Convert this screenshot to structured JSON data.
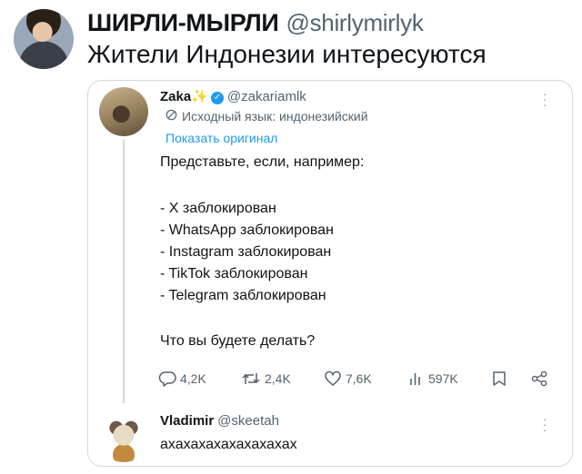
{
  "outer_post": {
    "display_name": "ШИРЛИ-МЫРЛИ",
    "handle": "@shirlymirlyk",
    "text": "Жители Индонезии интересуются"
  },
  "quoted_post": {
    "display_name": "Zaka",
    "name_emoji": "✨",
    "verified": true,
    "handle": "@zakariamlk",
    "translation_note": "Исходный язык: индонезийский",
    "show_original": "Показать оригинал",
    "lines": [
      "Представьте, если, например:",
      "- X заблокирован",
      "- WhatsApp заблокирован",
      "- Instagram заблокирован",
      "- TikTok заблокирован",
      "- Telegram заблокирован",
      "Что вы будете делать?"
    ],
    "stats": {
      "replies": "4,2K",
      "reposts": "2,4K",
      "likes": "7,6K",
      "views": "597K"
    }
  },
  "reply": {
    "display_name": "Vladimir",
    "handle": "@skeetah",
    "text": "ахахахахахахахахах"
  },
  "colors": {
    "accent": "#1d9bf0",
    "muted": "#536471",
    "border": "#cfd9de"
  },
  "icons": [
    "translate-icon",
    "verified-badge-icon",
    "reply-icon",
    "repost-icon",
    "like-icon",
    "views-icon",
    "bookmark-icon",
    "share-icon",
    "more-icon"
  ]
}
